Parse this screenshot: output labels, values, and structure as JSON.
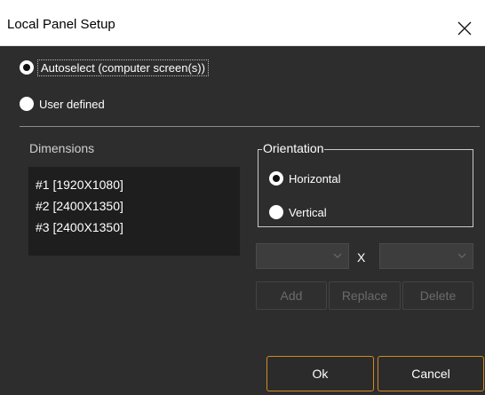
{
  "window": {
    "title": "Local Panel Setup"
  },
  "mode": {
    "autoselect_label": "Autoselect (computer screen(s))",
    "autoselect_checked": true,
    "user_defined_label": "User defined",
    "user_defined_checked": false
  },
  "dimensions": {
    "label": "Dimensions",
    "items": [
      "#1 [1920X1080]",
      "#2 [2400X1350]",
      "#3 [2400X1350]"
    ]
  },
  "orientation": {
    "label": "Orientation",
    "horizontal_label": "Horizontal",
    "horizontal_checked": true,
    "vertical_label": "Vertical",
    "vertical_checked": false
  },
  "size": {
    "separator": "X",
    "width_value": "",
    "height_value": ""
  },
  "buttons": {
    "add": "Add",
    "replace": "Replace",
    "delete": "Delete",
    "ok": "Ok",
    "cancel": "Cancel"
  },
  "colors": {
    "background": "#2d2d2d",
    "list_background": "#1e1e1e",
    "accent": "#d08a24"
  }
}
